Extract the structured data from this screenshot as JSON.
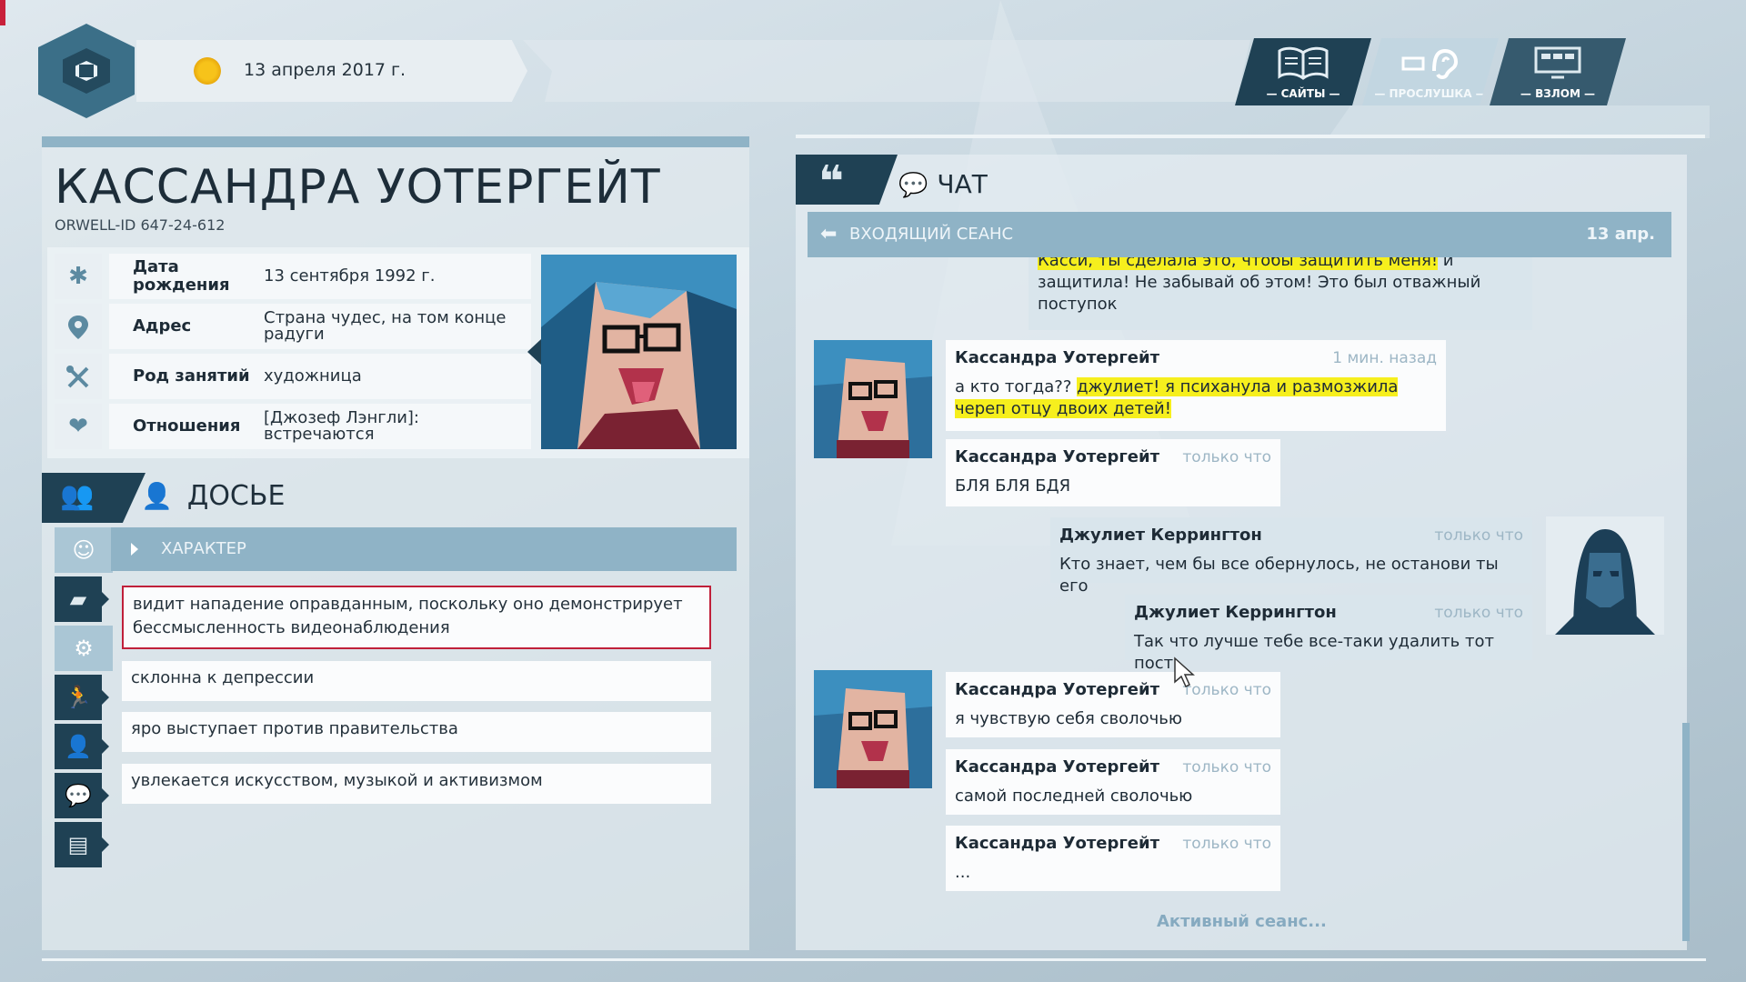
{
  "topbar": {
    "date": "13 апреля 2017 г.",
    "modes": [
      {
        "label": "— САЙТЫ —",
        "icon": "book-icon"
      },
      {
        "label": "— ПРОСЛУШКА —",
        "icon": "ear-icon"
      },
      {
        "label": "— ВЗЛОМ —",
        "icon": "monitor-icon"
      }
    ]
  },
  "profile": {
    "name": "КАССАНДРА УОТЕРГЕЙТ",
    "orwell_id": "ORWELL-ID  647-24-612",
    "rows": [
      {
        "icon": "asterisk-icon",
        "label": "Дата рождения",
        "value": "13 сентября 1992 г."
      },
      {
        "icon": "location-pin-icon",
        "label": "Адрес",
        "value": "Страна чудес, на том конце радуги"
      },
      {
        "icon": "tools-icon",
        "label": "Род занятий",
        "value": "художница"
      },
      {
        "icon": "heart-icon",
        "label": "Отношения",
        "value": "[Джозеф Лэнгли]: встречаются"
      }
    ]
  },
  "dossier": {
    "title": "ДОСЬЕ",
    "section": "ХАРАКТЕР",
    "side_icons": [
      "face-icon",
      "book-icon",
      "gears-icon",
      "running-icon",
      "person-badge-icon",
      "chat-icon",
      "document-icon"
    ],
    "traits": [
      "видит нападение оправданным, поскольку оно демонстрирует бессмысленность видеонаблюдения",
      "склонна к депрессии",
      "яро выступает против правительства",
      "увлекается искусством, музыкой и активизмом"
    ]
  },
  "chat": {
    "title": "ЧАТ",
    "session_label": "ВХОДЯЩИЙ СЕАНС",
    "session_date": "13 апр.",
    "partial_message": {
      "text_hl": "Касси, ты сделала это, чтобы защитить меня!",
      "text": " и защитила! Не забывай об этом! Это был отважный поступок"
    },
    "messages": [
      {
        "author": "Кассандра Уотергейт",
        "time": "1 мин. назад",
        "pre": "а кто тогда?? ",
        "hl": "джулиет! я психанула и размозжила череп отцу двоих детей!"
      },
      {
        "author": "Кассандра Уотергейт",
        "time": "только что",
        "text": "БЛЯ БЛЯ БДЯ"
      },
      {
        "author": "Джулиет Керрингтон",
        "time": "только что",
        "text": "Кто знает, чем бы все обернулось, не останови ты его"
      },
      {
        "author": "Джулиет Керрингтон",
        "time": "только что",
        "text": "Так что лучше тебе все-таки удалить тот пост"
      },
      {
        "author": "Кассандра Уотергейт",
        "time": "только что",
        "text": "я чувствую себя сволочью"
      },
      {
        "author": "Кассандра Уотергейт",
        "time": "только что",
        "text": "самой последней сволочью"
      },
      {
        "author": "Кассандра Уотергейт",
        "time": "только что",
        "text": "..."
      }
    ],
    "status": "Активный сеанс..."
  }
}
